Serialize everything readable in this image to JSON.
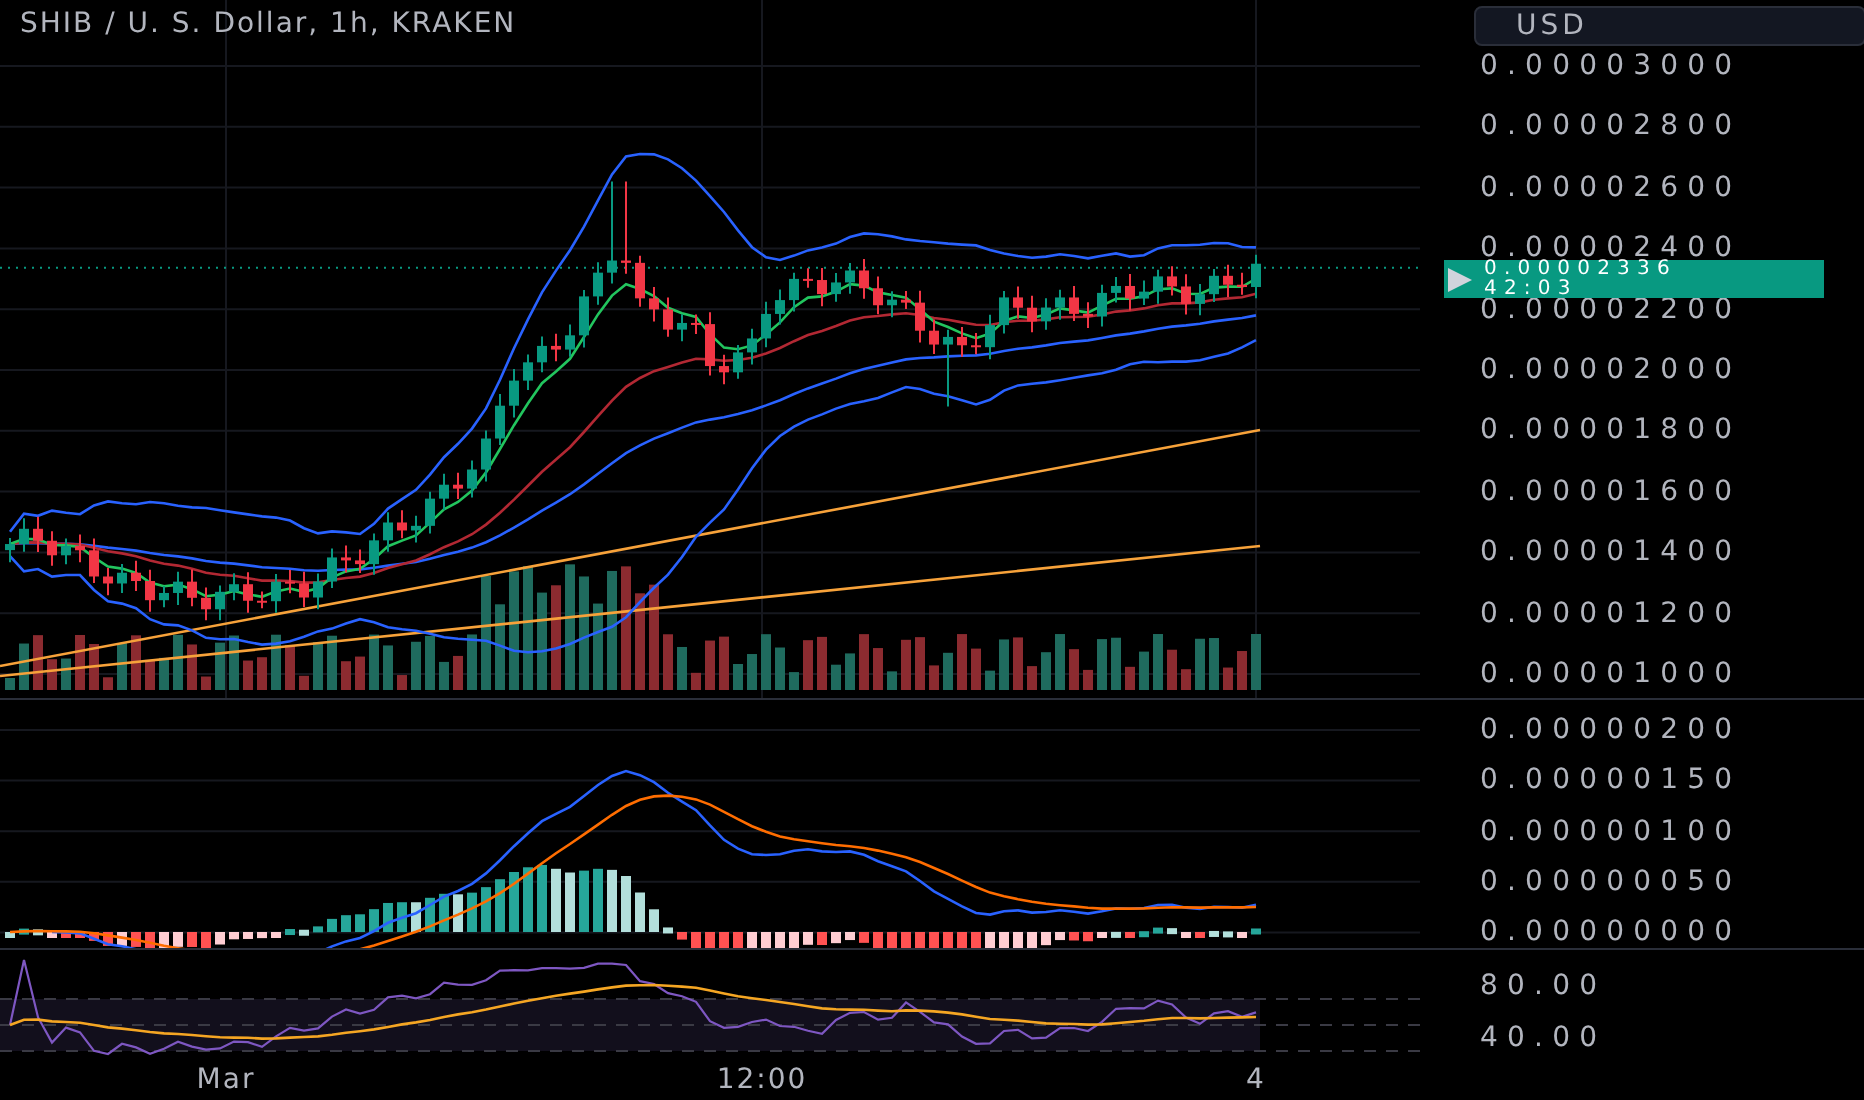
{
  "header": {
    "title": "SHIB / U. S. Dollar, 1h, KRAKEN"
  },
  "currency_button": {
    "label": "USD"
  },
  "price_axis": {
    "labels": [
      "0.00003000",
      "0.00002800",
      "0.00002600",
      "0.00002400",
      "0.00002200",
      "0.00002000",
      "0.00001800",
      "0.00001600",
      "0.00001400",
      "0.00001200",
      "0.00001000"
    ]
  },
  "last_price": {
    "price": "0.00002336",
    "countdown": "42:03"
  },
  "macd_axis": {
    "labels": [
      "0.00000200",
      "0.00000150",
      "0.00000100",
      "0.00000050",
      "0.00000000"
    ]
  },
  "rsi_axis": {
    "labels": [
      "80.00",
      "40.00"
    ]
  },
  "time_axis": {
    "labels": [
      "Mar",
      "12:00",
      "4"
    ]
  }
}
